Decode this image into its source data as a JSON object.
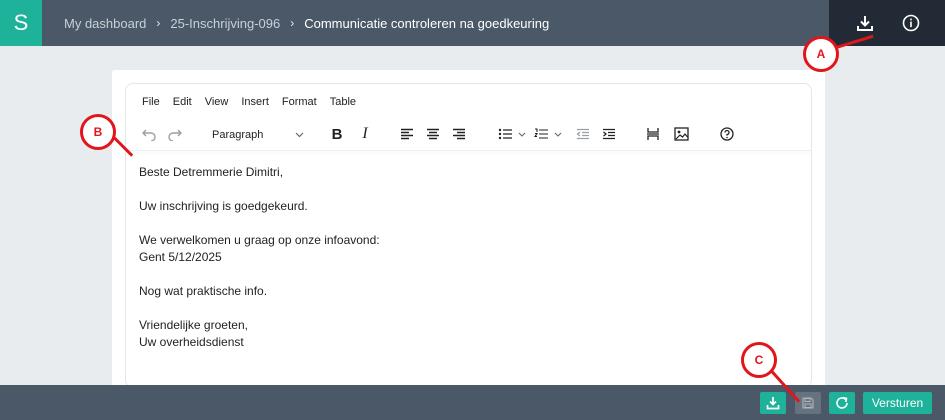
{
  "app": {
    "logo_letter": "S"
  },
  "breadcrumb": {
    "items": [
      {
        "label": "My dashboard"
      },
      {
        "label": "25-Inschrijving-096"
      },
      {
        "label": "Communicatie controleren na goedkeuring"
      }
    ],
    "separator": "›"
  },
  "header_actions": [
    {
      "icon": "download-icon"
    },
    {
      "icon": "info-icon"
    }
  ],
  "editor": {
    "menu": [
      "File",
      "Edit",
      "View",
      "Insert",
      "Format",
      "Table"
    ],
    "toolbar": {
      "format_select_value": "Paragraph",
      "bold": "B",
      "italic": "I"
    },
    "content": {
      "greeting": "Beste Detremmerie Dimitri,",
      "line1": "Uw inschrijving is goedgekeurd.",
      "line2a": "We verwelkomen u graag op onze infoavond:",
      "line2b": "Gent 5/12/2025",
      "line3": "Nog wat praktische info.",
      "closing1": "Vriendelijke groeten,",
      "closing2": "Uw overheidsdienst"
    }
  },
  "footer_actions": {
    "send_label": "Versturen"
  },
  "annotations": [
    {
      "label": "A"
    },
    {
      "label": "B"
    },
    {
      "label": "C"
    }
  ],
  "colors": {
    "accent": "#1fb29a",
    "topbar": "#4b5868",
    "topbar_dark": "#222b35",
    "annotation": "#e0161b"
  }
}
